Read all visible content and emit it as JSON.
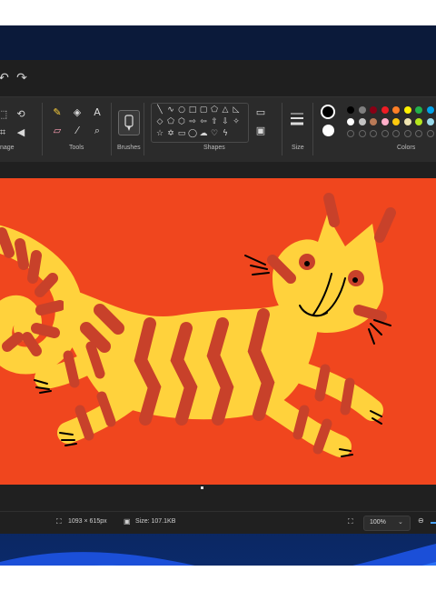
{
  "ribbon": {
    "groups": {
      "image": "nage",
      "tools": "Tools",
      "brushes": "Brushes",
      "shapes": "Shapes",
      "size": "Size",
      "colors": "Colors"
    }
  },
  "toolbar_icons": [
    "undo-icon",
    "redo-icon"
  ],
  "tools": [
    "pencil-icon",
    "fill-icon",
    "text-icon",
    "eraser-icon",
    "color-picker-icon",
    "magnifier-icon"
  ],
  "colors": {
    "current_primary": "#000000",
    "current_secondary": "#ffffff",
    "palette_row1": [
      "#000000",
      "#7f7f7f",
      "#880015",
      "#ed1c24",
      "#ff7f27",
      "#fff200",
      "#22b14c",
      "#00a2e8"
    ],
    "palette_row2": [
      "#ffffff",
      "#c3c3c3",
      "#b97a57",
      "#ffaec9",
      "#ffc90e",
      "#efe4b0",
      "#b5e61d",
      "#99d9ea"
    ],
    "canvas_bg": "#f0461e",
    "tiger_body": "#ffd23c",
    "tiger_stripes": "#c8412a"
  },
  "status": {
    "dimensions": "1093 × 615px",
    "size": "Size: 107.1KB",
    "zoom": "100%"
  }
}
